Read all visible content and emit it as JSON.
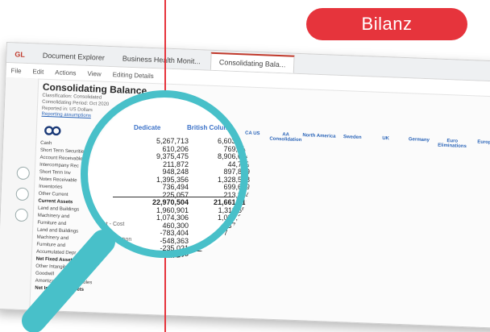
{
  "badge": {
    "label": "Bilanz"
  },
  "app": {
    "logo_text": "GL",
    "tabs": [
      "Document Explorer",
      "Business Health Monit...",
      "Consolidating Bala..."
    ],
    "toolbar": [
      "File",
      "Edit",
      "Actions",
      "View",
      "Editing Details"
    ]
  },
  "report": {
    "title": "Consolidating Balance",
    "meta": [
      "Classification: Consolidated",
      "Consolidating Period: Oct 2020",
      "Reported in: US Dollars"
    ],
    "link": "Reporting assumptions",
    "column_headers": [
      "Dedicate",
      "British Columbia",
      "CA US",
      "AA Consolidation",
      "North America",
      "Sweden",
      "UK",
      "Germany",
      "Euro Eliminations",
      "Europe",
      "Glo..."
    ],
    "row_labels": [
      "Cash",
      "Short Term Securities",
      "Account Receivable",
      "Intercompany Rec",
      "Short Term Inv",
      "Notes Receivable",
      "Inventories",
      "Other Current",
      "Current Assets",
      "Land and Buildings",
      "Machinery and",
      "Furniture and",
      "Land and Buildings",
      "Machinery and",
      "Furniture and",
      "Accumulated Depr",
      "Net Fixed Assets",
      "Other Intangible Assets",
      "Goodwill",
      "Amortization of Intangibles",
      "Net Intangible Assets"
    ],
    "bold_rows": [
      8,
      16,
      20
    ]
  },
  "lens": {
    "rows": [
      {
        "label": "",
        "a": "5,267,713",
        "b": "6,603,757"
      },
      {
        "label": "",
        "a": "610,206",
        "b": "769,836"
      },
      {
        "label": "",
        "a": "9,375,475",
        "b": "8,906,644"
      },
      {
        "label": "",
        "a": "211,872",
        "b": "44,719"
      },
      {
        "label": "",
        "a": "948,248",
        "b": "897,879"
      },
      {
        "label": "",
        "a": "1,395,356",
        "b": "1,328,588"
      },
      {
        "label": "",
        "a": "736,494",
        "b": "699,689"
      },
      {
        "label": "",
        "a": "225,057",
        "b": "213,804"
      },
      {
        "label": "",
        "a": "22,970,504",
        "b": "21,661,316",
        "total": true
      },
      {
        "label": "",
        "a": "1,960,901",
        "b": "1,311,658"
      },
      {
        "label": "",
        "a": "1,074,306",
        "b": "1,020,313"
      },
      {
        "label": "ent - Cost",
        "a": "460,300",
        "b": "437,285"
      },
      {
        "label": "",
        "a": "-783,404",
        "b": "-744,233"
      },
      {
        "label": "Depreciation",
        "a": "-548,363",
        "b": "-520,965"
      },
      {
        "label": "",
        "a": "-235,021",
        "b": "-223,270"
      },
      {
        "label": "",
        "a": "1,348,428",
        "b": "1,...",
        "total": true
      }
    ],
    "col_hdr_a": "Dedicate",
    "col_hdr_b": "British Columbia"
  }
}
